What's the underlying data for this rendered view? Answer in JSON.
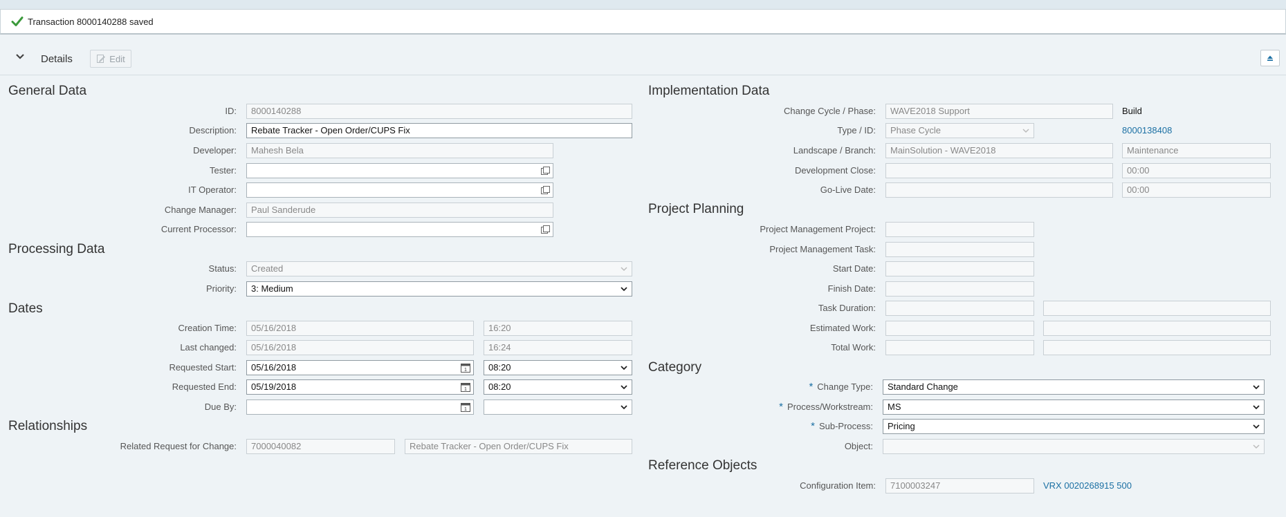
{
  "message": {
    "text": "Transaction 8000140288 saved"
  },
  "toolbar": {
    "title": "Details",
    "edit_label": "Edit"
  },
  "general": {
    "title": "General Data",
    "id_label": "ID:",
    "id_value": "8000140288",
    "description_label": "Description:",
    "description_value": "Rebate Tracker - Open Order/CUPS Fix",
    "developer_label": "Developer:",
    "developer_value": "Mahesh Bela",
    "tester_label": "Tester:",
    "tester_value": "",
    "it_operator_label": "IT Operator:",
    "it_operator_value": "",
    "change_manager_label": "Change Manager:",
    "change_manager_value": "Paul Sanderude",
    "current_processor_label": "Current Processor:",
    "current_processor_value": ""
  },
  "processing": {
    "title": "Processing Data",
    "status_label": "Status:",
    "status_value": "Created",
    "priority_label": "Priority:",
    "priority_value": "3: Medium"
  },
  "dates": {
    "title": "Dates",
    "creation_label": "Creation Time:",
    "creation_date": "05/16/2018",
    "creation_time": "16:20",
    "last_changed_label": "Last changed:",
    "last_changed_date": "05/16/2018",
    "last_changed_time": "16:24",
    "req_start_label": "Requested Start:",
    "req_start_date": "05/16/2018",
    "req_start_time": "08:20",
    "req_end_label": "Requested End:",
    "req_end_date": "05/19/2018",
    "req_end_time": "08:20",
    "due_by_label": "Due By:",
    "due_by_date": "",
    "due_by_time": ""
  },
  "relationships": {
    "title": "Relationships",
    "rfc_label": "Related Request for Change:",
    "rfc_id": "7000040082",
    "rfc_desc": "Rebate Tracker - Open Order/CUPS Fix"
  },
  "implementation": {
    "title": "Implementation Data",
    "cycle_label": "Change Cycle / Phase:",
    "cycle_value": "WAVE2018 Support",
    "phase_value": "Build",
    "type_label": "Type / ID:",
    "type_value": "Phase Cycle",
    "type_id": "8000138408",
    "landscape_label": "Landscape / Branch:",
    "landscape_value": "MainSolution - WAVE2018",
    "branch_value": "Maintenance",
    "dev_close_label": "Development Close:",
    "dev_close_date": "",
    "dev_close_time": "00:00",
    "golive_label": "Go-Live Date:",
    "golive_date": "",
    "golive_time": "00:00"
  },
  "project": {
    "title": "Project Planning",
    "pm_project_label": "Project Management Project:",
    "pm_project_value": "",
    "pm_task_label": "Project Management Task:",
    "pm_task_value": "",
    "start_label": "Start Date:",
    "start_value": "",
    "finish_label": "Finish Date:",
    "finish_value": "",
    "duration_label": "Task Duration:",
    "duration_value": "",
    "duration_unit": "",
    "est_work_label": "Estimated Work:",
    "est_work_value": "",
    "est_work_unit": "",
    "total_work_label": "Total Work:",
    "total_work_value": "",
    "total_work_unit": ""
  },
  "category": {
    "title": "Category",
    "required_mark": "*",
    "change_type_label": "Change Type:",
    "change_type_value": "Standard Change",
    "process_label": "Process/Workstream:",
    "process_value": "MS",
    "subprocess_label": "Sub-Process:",
    "subprocess_value": "Pricing",
    "object_label": "Object:",
    "object_value": ""
  },
  "reference": {
    "title": "Reference Objects",
    "config_label": "Configuration Item:",
    "config_value": "7100003247",
    "config_link": "VRX 0020268915 500"
  },
  "colors": {
    "link": "#1a6fa3",
    "success": "#3c9a3c",
    "background": "#eef3f6"
  }
}
